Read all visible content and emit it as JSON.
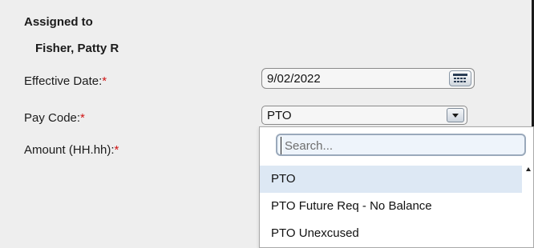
{
  "assigned": {
    "label": "Assigned to",
    "name": "Fisher, Patty R"
  },
  "effective_date": {
    "label": "Effective Date:",
    "required_mark": "*",
    "value": "9/02/2022",
    "button_icon": "calendar-icon"
  },
  "pay_code": {
    "label": "Pay Code:",
    "required_mark": "*",
    "value": "PTO",
    "button_icon": "chevron-down-icon"
  },
  "amount": {
    "label": "Amount (HH.hh):",
    "required_mark": "*"
  },
  "dropdown": {
    "search_placeholder": "Search...",
    "options": [
      "PTO",
      "PTO Future Req - No Balance",
      "PTO Unexcused"
    ],
    "selected_index": 0
  },
  "colors": {
    "required": "#d01414",
    "selected_option_bg": "#dde8f4",
    "panel_bg": "#eeeeee"
  }
}
